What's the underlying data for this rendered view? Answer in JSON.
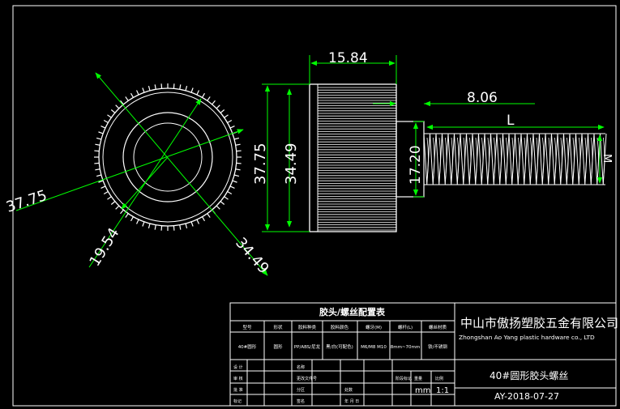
{
  "dimensions": {
    "head_length": "15.84",
    "thread_offset": "8.06",
    "head_outer_dia": "37.75",
    "head_inner_dia": "34.49",
    "collar_dia": "17.20",
    "thread_length_symbol": "L",
    "thread_dia_symbol": "M",
    "front_outer_dia": "37.75",
    "front_collar_dia": "19.54",
    "front_inner_dia": "34.49"
  },
  "title_block": {
    "table_title": "胶头/螺丝配置表",
    "headers": [
      "型号",
      "形状",
      "胶料种类",
      "胶料颜色",
      "螺牙(M)",
      "螺杆(L)",
      "螺丝材质"
    ],
    "row": [
      "40#圆形",
      "圆形",
      "PP/ABS/尼龙",
      "黑/白(可配色)",
      "M6/M8 M10",
      "8mm~70mm",
      "铁/不锈钢"
    ],
    "company_cn": "中山市傲扬塑胶五金有限公司",
    "company_en": "Zhongshan Ao Yang plastic hardware co., LTD",
    "part_name": "40#圆形胶头螺丝",
    "drawing_no": "AY-2018-07-27",
    "unit": "mm",
    "scale": "1:1",
    "labels": {
      "design": "设 计",
      "check": "审 核",
      "approve": "批 准",
      "std": "标记",
      "qty": "处数",
      "sign": "签名",
      "date": "年 月 日",
      "stage": "阶段标记",
      "weight": "重量",
      "ratio": "比例",
      "name_lbl": "名称",
      "file_lbl": "更改文件号",
      "sub_lbl": "分区"
    }
  },
  "colors": {
    "background": "#000000",
    "line": "#ffffff",
    "dimension": "#00ff00"
  }
}
